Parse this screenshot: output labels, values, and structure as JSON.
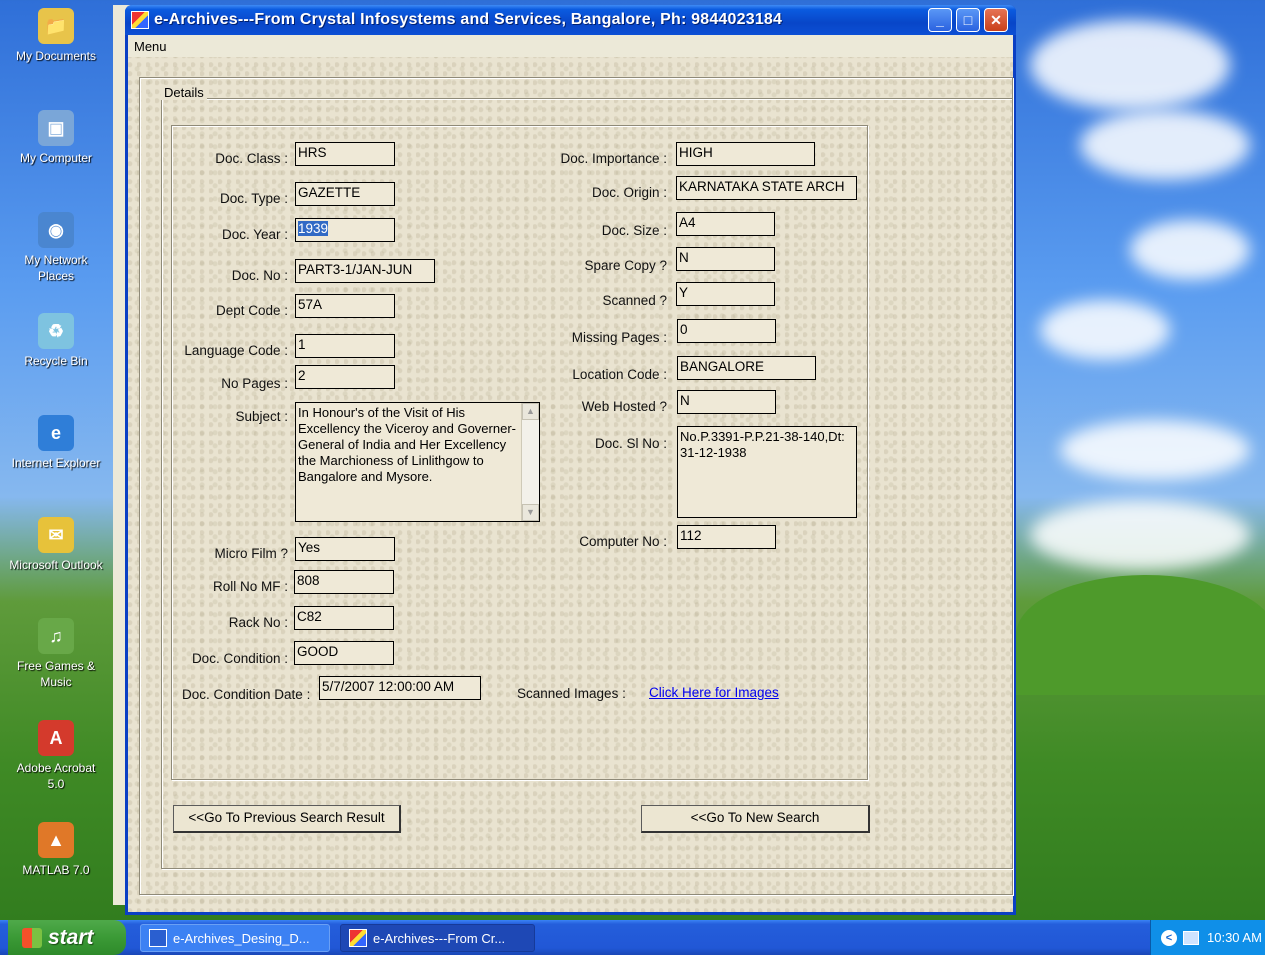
{
  "desktop": {
    "icons": [
      {
        "label": "My Documents",
        "icon": "folder-documents-icon",
        "color": "#e8c44a"
      },
      {
        "label": "My Computer",
        "icon": "computer-icon",
        "color": "#7aa6d8"
      },
      {
        "label": "My Network Places",
        "icon": "network-icon",
        "color": "#4a86d0"
      },
      {
        "label": "Recycle Bin",
        "icon": "recycle-bin-icon",
        "color": "#7ec3e0"
      },
      {
        "label": "Internet Explorer",
        "icon": "internet-explorer-icon",
        "color": "#2f7ed8"
      },
      {
        "label": "Microsoft Outlook",
        "icon": "outlook-icon",
        "color": "#e7c23a"
      },
      {
        "label": "Free Games & Music",
        "icon": "games-music-icon",
        "color": "#68a848"
      },
      {
        "label": "Adobe Acrobat 5.0",
        "icon": "acrobat-icon",
        "color": "#d43a2c"
      },
      {
        "label": "MATLAB 7.0",
        "icon": "matlab-icon",
        "color": "#e07828"
      }
    ]
  },
  "window": {
    "title": "e-Archives---From Crystal Infosystems and Services, Bangalore, Ph: 9844023184",
    "menu": "Menu",
    "group_label": "Details",
    "left_fields": [
      {
        "label": "Doc. Class :",
        "value": "HRS"
      },
      {
        "label": "Doc. Type :",
        "value": "GAZETTE"
      },
      {
        "label": "Doc. Year :",
        "value": "1939"
      },
      {
        "label": "Doc. No :",
        "value": "PART3-1/JAN-JUN"
      },
      {
        "label": "Dept Code :",
        "value": "57A"
      },
      {
        "label": "Language Code :",
        "value": "1"
      },
      {
        "label": "No Pages :",
        "value": "2"
      },
      {
        "label": "Subject :",
        "value": "In Honour's of the Visit of His Excellency the Viceroy  and Governer-General of India and Her Excellency the Marchioness of Linlithgow to Bangalore and Mysore."
      },
      {
        "label": "Micro Film ?",
        "value": "Yes"
      },
      {
        "label": "Roll No MF :",
        "value": "808"
      },
      {
        "label": "Rack No :",
        "value": "C82"
      },
      {
        "label": "Doc. Condition :",
        "value": "GOOD"
      },
      {
        "label": "Doc. Condition Date :",
        "value": "5/7/2007 12:00:00 AM"
      }
    ],
    "right_fields": [
      {
        "label": "Doc. Importance :",
        "value": "HIGH"
      },
      {
        "label": "Doc. Origin :",
        "value": "KARNATAKA STATE ARCH"
      },
      {
        "label": "Doc. Size :",
        "value": "A4"
      },
      {
        "label": "Spare Copy ?",
        "value": "N"
      },
      {
        "label": "Scanned ?",
        "value": "Y"
      },
      {
        "label": "Missing Pages :",
        "value": "0"
      },
      {
        "label": "Location Code :",
        "value": "BANGALORE"
      },
      {
        "label": "Web Hosted ?",
        "value": "N"
      },
      {
        "label": "Doc. Sl No :",
        "value": "No.P.3391-P.P.21-38-140,Dt: 31-12-1938"
      },
      {
        "label": "Computer No :",
        "value": "112"
      }
    ],
    "scanned_images_label": "Scanned Images :",
    "scanned_images_link": "Click Here for Images",
    "prev_button": "<<Go To Previous Search Result",
    "new_search_button": "<<Go To New Search"
  },
  "taskbar": {
    "start": "start",
    "tasks": [
      "e-Archives_Desing_D...",
      "e-Archives---From Cr..."
    ],
    "clock": "10:30 AM"
  }
}
